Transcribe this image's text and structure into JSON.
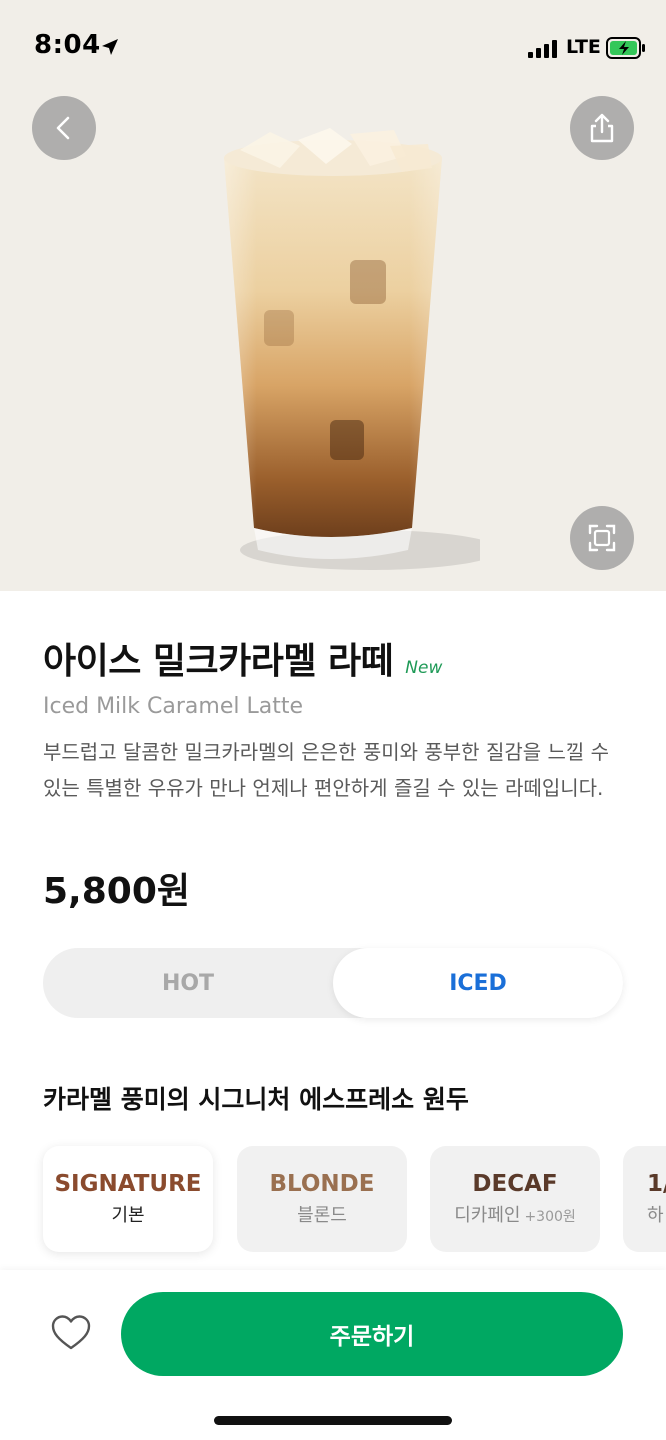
{
  "status_bar": {
    "time": "8:04",
    "network": "LTE",
    "icons": [
      "location-arrow-icon",
      "signal-icon",
      "battery-charging-icon"
    ]
  },
  "nav": {
    "back_icon": "chevron-left-icon",
    "share_icon": "share-icon",
    "fullscreen_icon": "fullscreen-icon"
  },
  "product": {
    "title": "아이스 밀크카라멜 라떼",
    "badge": "New",
    "subtitle": "Iced Milk Caramel Latte",
    "description": "부드럽고 달콤한 밀크카라멜의 은은한 풍미와 풍부한 질감을 느낄 수 있는 특별한 우유가 만나 언제나 편안하게 즐길 수 있는 라떼입니다.",
    "price": "5,800원"
  },
  "temperature": {
    "options": [
      "HOT",
      "ICED"
    ],
    "selected": "ICED"
  },
  "beans": {
    "section_title": "카라멜 풍미의 시그니처 에스프레소 원두",
    "options": [
      {
        "name": "SIGNATURE",
        "sub": "기본",
        "extra": "",
        "selected": true
      },
      {
        "name": "BLONDE",
        "sub": "블론드",
        "extra": "",
        "selected": false
      },
      {
        "name": "DECAF",
        "sub": "디카페인",
        "extra": "+300원",
        "selected": false
      },
      {
        "name": "1/",
        "sub": "하",
        "extra": "",
        "selected": false
      }
    ]
  },
  "bottom": {
    "favorite_icon": "heart-outline-icon",
    "order_label": "주문하기"
  },
  "colors": {
    "brand_green": "#00a862",
    "new_badge": "#1f9a57",
    "iced_blue": "#1a6fd8",
    "hero_bg": "#f1eee8"
  }
}
